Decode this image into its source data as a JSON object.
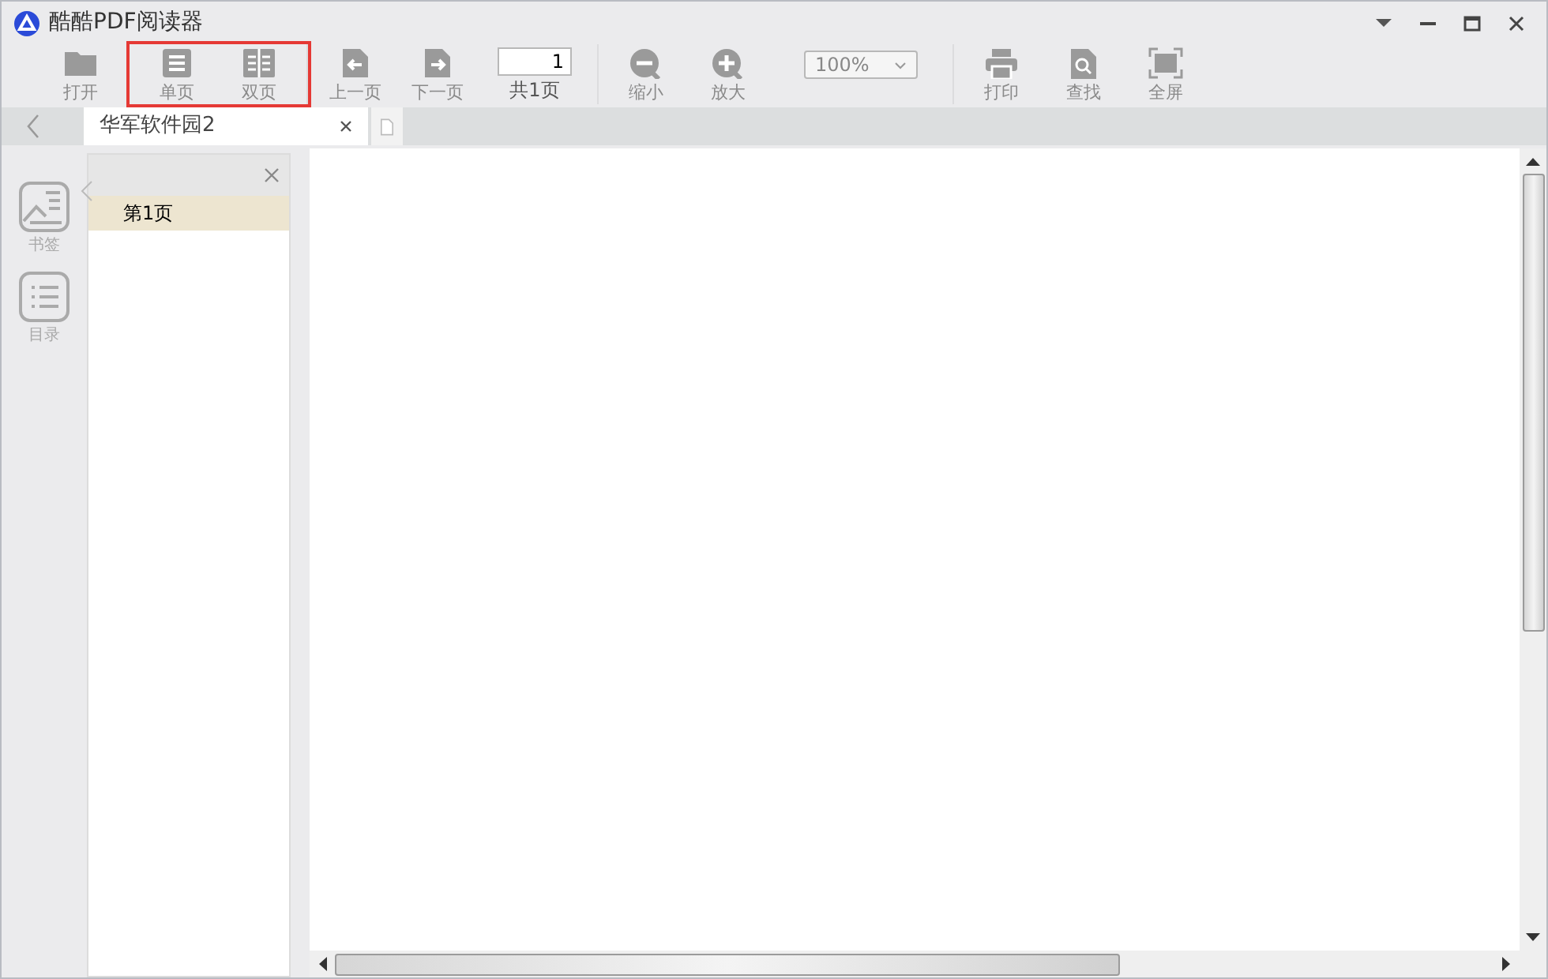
{
  "window": {
    "title": "酷酷PDF阅读器"
  },
  "toolbar": {
    "groups": [
      {
        "highlighted": false,
        "items": [
          {
            "kind": "button",
            "label": "打开"
          }
        ]
      },
      {
        "highlighted": true,
        "items": [
          {
            "kind": "button",
            "label": "单页"
          },
          {
            "kind": "button",
            "label": "双页"
          }
        ]
      },
      {
        "highlighted": false,
        "items": [
          {
            "kind": "button",
            "label": "上一页"
          },
          {
            "kind": "button",
            "label": "下一页"
          },
          {
            "kind": "pagebox",
            "value": "1",
            "label": "共1页"
          }
        ]
      },
      {
        "highlighted": false,
        "items": [
          {
            "kind": "button",
            "label": "缩小"
          },
          {
            "kind": "button",
            "label": "放大"
          },
          {
            "kind": "zoombox",
            "value": "100%"
          }
        ]
      },
      {
        "highlighted": false,
        "items": [
          {
            "kind": "button",
            "label": "打印"
          },
          {
            "kind": "button",
            "label": "查找"
          },
          {
            "kind": "button",
            "label": "全屏"
          }
        ]
      }
    ]
  },
  "tabs": [
    {
      "label": "华军软件园2",
      "selected": true
    }
  ],
  "rail": [
    {
      "label": "书签"
    },
    {
      "label": "目录"
    }
  ],
  "panel": {
    "items": [
      {
        "label": "第1页",
        "selected": true
      }
    ]
  }
}
